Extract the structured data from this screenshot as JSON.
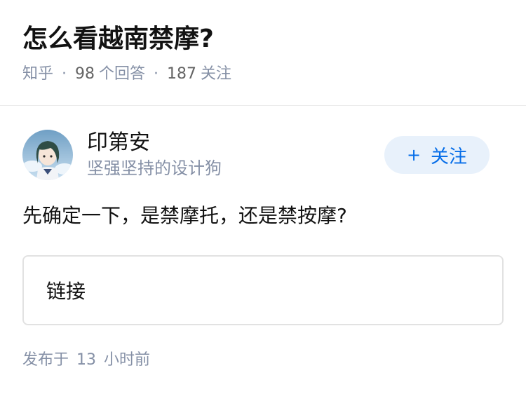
{
  "question": {
    "title": "怎么看越南禁摩?",
    "source": "知乎",
    "answers_count": "98",
    "answers_label": "个回答",
    "followers_count": "187",
    "followers_label": "关注"
  },
  "answer": {
    "author_name": "印第安",
    "author_bio": "坚强坚持的设计狗",
    "follow_plus": "+",
    "follow_label": "关注",
    "content": "先确定一下，是禁摩托，还是禁按摩?",
    "link_label": "链接",
    "published_prefix": "发布于",
    "published_num": "13",
    "published_suffix": "小时前"
  },
  "colors": {
    "accent": "#056de8",
    "follow_bg": "#e8f1fb",
    "meta_gray": "#8590a6"
  },
  "icons": {
    "avatar": "avatar-illustration"
  }
}
